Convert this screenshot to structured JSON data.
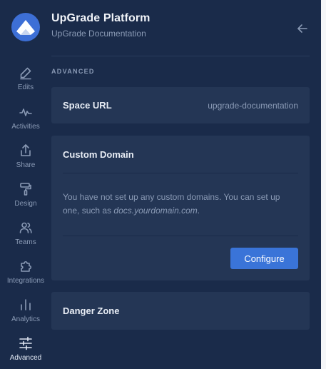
{
  "app": {
    "title": "UpGrade Platform",
    "subtitle": "UpGrade Documentation"
  },
  "sidebar": {
    "items": [
      {
        "label": "Edits",
        "icon": "edit-icon"
      },
      {
        "label": "Activities",
        "icon": "activity-icon"
      },
      {
        "label": "Share",
        "icon": "share-icon"
      },
      {
        "label": "Design",
        "icon": "paint-roller-icon"
      },
      {
        "label": "Teams",
        "icon": "users-icon"
      },
      {
        "label": "Integrations",
        "icon": "puzzle-icon"
      },
      {
        "label": "Analytics",
        "icon": "bar-chart-icon"
      },
      {
        "label": "Advanced",
        "icon": "sliders-icon",
        "active": true
      }
    ]
  },
  "main": {
    "section_heading": "ADVANCED",
    "space_url": {
      "title": "Space URL",
      "value": "upgrade-documentation"
    },
    "custom_domain": {
      "title": "Custom Domain",
      "description_prefix": "You have not set up any custom domains. You can set up one, such as ",
      "description_example": "docs.yourdomain.com",
      "description_suffix": ".",
      "configure_label": "Configure"
    },
    "danger_zone": {
      "title": "Danger Zone"
    }
  },
  "colors": {
    "background": "#1a2b4a",
    "card": "#243655",
    "accent": "#3a74d8",
    "muted_text": "#8a9ab5"
  }
}
